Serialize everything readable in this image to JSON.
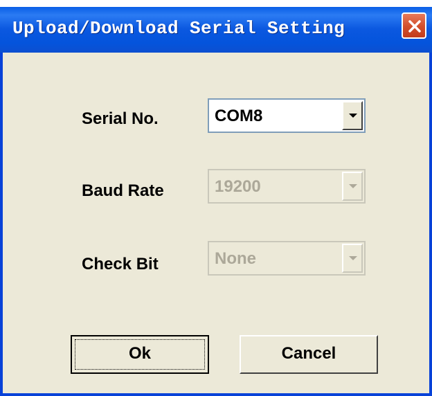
{
  "window": {
    "title": "Upload/Download Serial Setting"
  },
  "serial_no": {
    "label": "Serial No.",
    "value": "COM8",
    "enabled": true
  },
  "baud_rate": {
    "label": "Baud Rate",
    "value": "19200",
    "enabled": false
  },
  "check_bit": {
    "label": "Check Bit",
    "value": "None",
    "enabled": false
  },
  "buttons": {
    "ok": "Ok",
    "cancel": "Cancel"
  },
  "icons": {
    "close": "close-icon",
    "dropdown": "chevron-down-icon"
  },
  "colors": {
    "titlebar": "#0454dc",
    "dialog_bg": "#ece9d8",
    "close_button": "#d24e2b"
  }
}
